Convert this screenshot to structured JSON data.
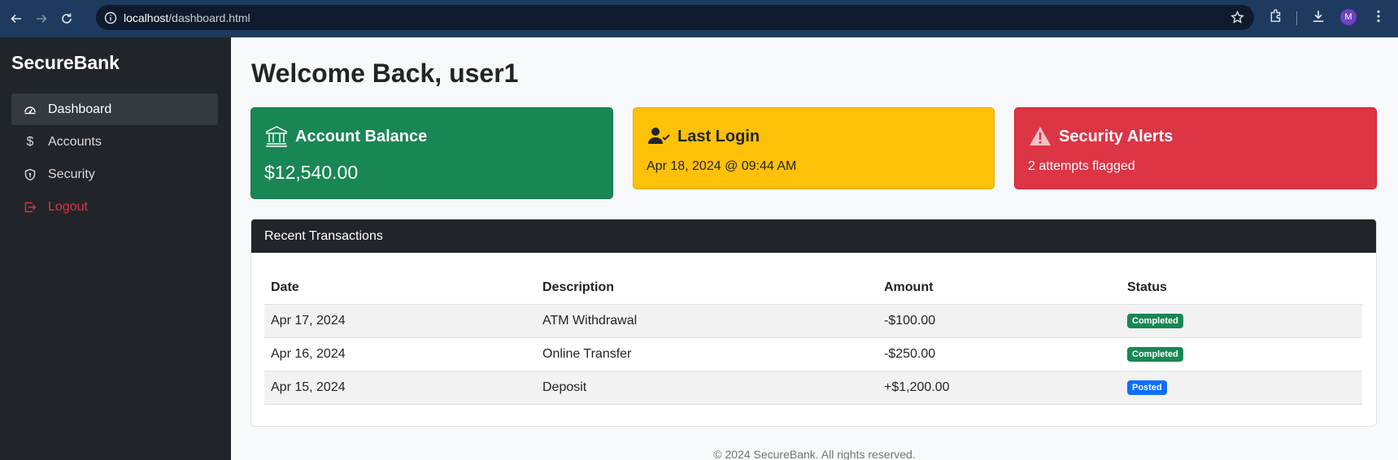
{
  "browser": {
    "url_host": "localhost",
    "url_path": "/dashboard.html",
    "profile_initial": "M"
  },
  "sidebar": {
    "brand": "SecureBank",
    "items": [
      {
        "label": "Dashboard",
        "icon": "speedometer-icon",
        "active": true
      },
      {
        "label": "Accounts",
        "icon": "dollar-icon"
      },
      {
        "label": "Security",
        "icon": "shield-icon"
      },
      {
        "label": "Logout",
        "icon": "logout-icon",
        "color": "#dc3545"
      }
    ]
  },
  "main": {
    "welcome": "Welcome Back, user1",
    "cards": {
      "balance": {
        "title": "Account Balance",
        "value": "$12,540.00",
        "icon": "bank-icon",
        "color": "#198754"
      },
      "last_login": {
        "title": "Last Login",
        "value": "Apr 18, 2024 @ 09:44 AM",
        "icon": "person-check-icon",
        "color": "#ffc107"
      },
      "alerts": {
        "title": "Security Alerts",
        "value": "2 attempts flagged",
        "icon": "warning-icon",
        "color": "#dc3545"
      }
    },
    "transactions": {
      "title": "Recent Transactions",
      "columns": [
        "Date",
        "Description",
        "Amount",
        "Status"
      ],
      "rows": [
        {
          "date": "Apr 17, 2024",
          "description": "ATM Withdrawal",
          "amount": "-$100.00",
          "status": "Completed"
        },
        {
          "date": "Apr 16, 2024",
          "description": "Online Transfer",
          "amount": "-$250.00",
          "status": "Completed"
        },
        {
          "date": "Apr 15, 2024",
          "description": "Deposit",
          "amount": "+$1,200.00",
          "status": "Posted"
        }
      ]
    },
    "footer": "© 2024 SecureBank. All rights reserved."
  }
}
